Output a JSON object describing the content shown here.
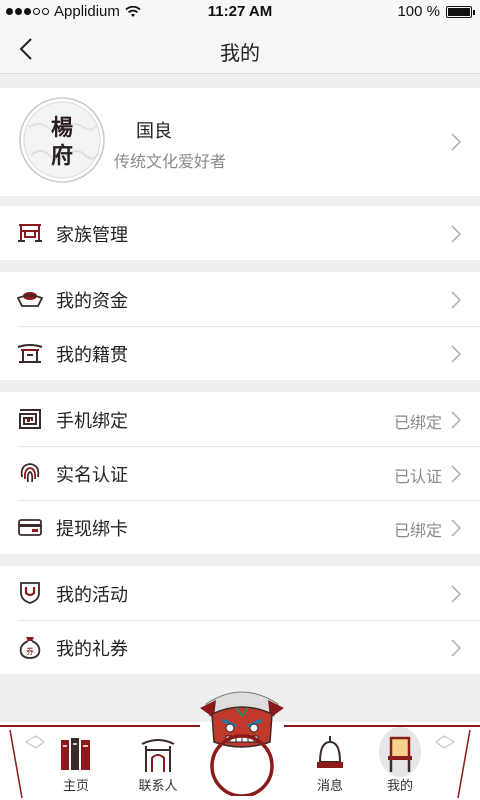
{
  "status_bar": {
    "carrier": "Applidium",
    "time": "11:27 AM",
    "battery": "100 %"
  },
  "nav": {
    "title": "我的",
    "back_icon": "chevron-left-icon"
  },
  "profile": {
    "avatar_seal_text": "楊府",
    "name": "国良",
    "subtitle": "传统文化爱好者"
  },
  "sections": [
    {
      "items": [
        {
          "label": "家族管理",
          "status": "",
          "icon": "ancestral-gate-icon"
        }
      ]
    },
    {
      "items": [
        {
          "label": "我的资金",
          "status": "",
          "icon": "treasure-ingot-icon"
        },
        {
          "label": "我的籍贯",
          "status": "",
          "icon": "pavilion-icon"
        }
      ]
    },
    {
      "items": [
        {
          "label": "手机绑定",
          "status": "已绑定",
          "icon": "spiral-pattern-icon"
        },
        {
          "label": "实名认证",
          "status": "已认证",
          "icon": "fingerprint-icon"
        },
        {
          "label": "提现绑卡",
          "status": "已绑定",
          "icon": "bank-card-icon"
        }
      ]
    },
    {
      "items": [
        {
          "label": "我的活动",
          "status": "",
          "icon": "shield-badge-icon"
        },
        {
          "label": "我的礼券",
          "status": "",
          "icon": "coupon-bag-icon"
        }
      ]
    }
  ],
  "tabbar": {
    "tabs": [
      {
        "label": "主页",
        "icon": "books-icon"
      },
      {
        "label": "联系人",
        "icon": "archway-icon"
      },
      {
        "label": "消息",
        "icon": "bell-icon"
      },
      {
        "label": "我的",
        "icon": "chair-icon",
        "active": true
      }
    ],
    "center_icon": "lion-head-icon"
  },
  "colors": {
    "accent_red": "#8b1a1a",
    "icon_dark": "#3a2a2a",
    "background": "#efefef",
    "muted_text": "#8a8a8a"
  }
}
